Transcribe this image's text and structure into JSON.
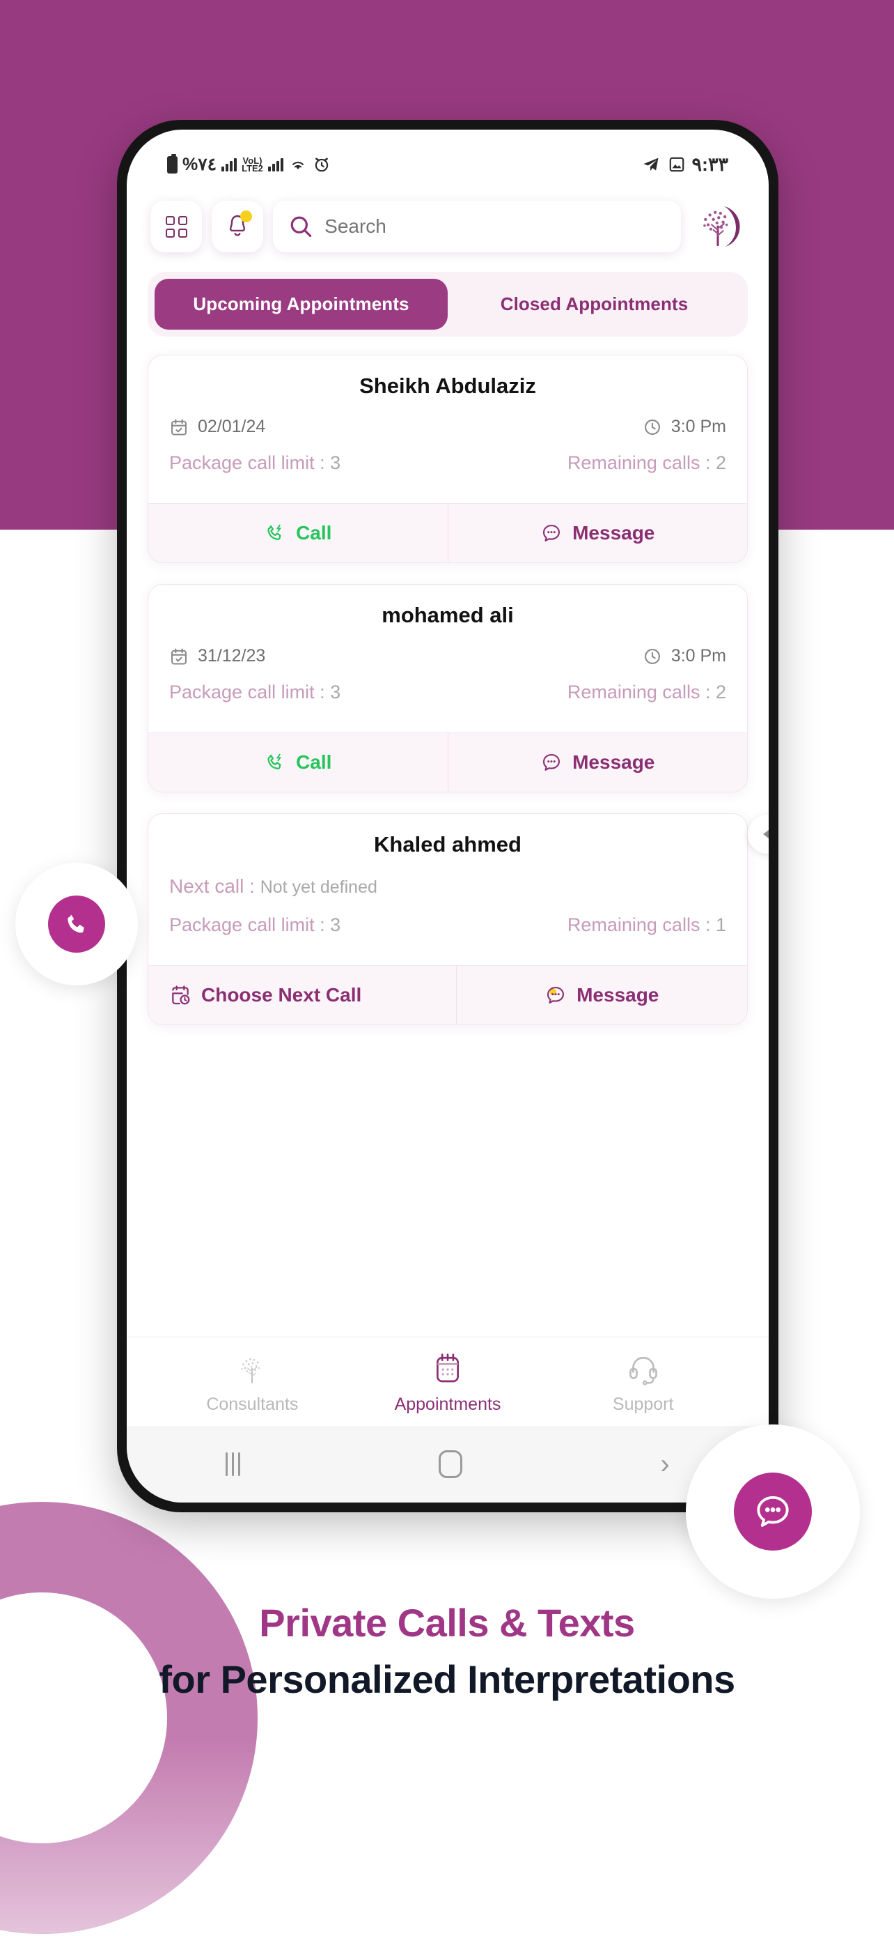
{
  "colors": {
    "brand_purple": "#983A80",
    "brand_purple_dark": "#8B2F74",
    "accent_magenta": "#B3308F",
    "call_green": "#25C55B",
    "tab_bg": "#FAF1F7",
    "ring_pink": "#C075AC",
    "bell_dot_yellow": "#F5D01E"
  },
  "statusbar": {
    "battery_text": "%٧٤",
    "network_label": "VoLTE2",
    "network_sub": "LTE2",
    "volte_top": "VoL)",
    "time": "٩:٣٣",
    "icons": [
      "battery-icon",
      "signal-bars-icon",
      "volte-icon",
      "signal-bars-2-icon",
      "wifi-icon",
      "alarm-icon",
      "telegram-icon",
      "photo-icon"
    ]
  },
  "header": {
    "grid_button": "grid-menu-button",
    "bell_button": "notifications-button",
    "search": {
      "value": "",
      "placeholder": "Search"
    },
    "logo": "tree-crescent-logo"
  },
  "tabs": [
    {
      "label": "Upcoming Appointments",
      "active": true
    },
    {
      "label": "Closed Appointments",
      "active": false
    }
  ],
  "appointments": [
    {
      "name": "Sheikh Abdulaziz",
      "date": "02/01/24",
      "time": "3:0 Pm",
      "package_label": "Package call limit :",
      "package_value": "3",
      "remaining_label": "Remaining calls :",
      "remaining_value": "2",
      "primary_action": "Call",
      "primary_kind": "call",
      "secondary_action": "Message"
    },
    {
      "name": "mohamed ali",
      "date": "31/12/23",
      "time": "3:0 Pm",
      "package_label": "Package call limit :",
      "package_value": "3",
      "remaining_label": "Remaining calls :",
      "remaining_value": "2",
      "primary_action": "Call",
      "primary_kind": "call",
      "secondary_action": "Message"
    },
    {
      "name": "Khaled ahmed",
      "next_call_label": "Next call :",
      "next_call_value": "Not yet defined",
      "package_label": "Package call limit  :",
      "package_value": "3",
      "remaining_label": "Remaining calls  :",
      "remaining_value": "1",
      "primary_action": "Choose Next Call",
      "primary_kind": "choose",
      "secondary_action": "Message"
    }
  ],
  "bottom_nav": [
    {
      "label": "Consultants",
      "icon": "tree-icon",
      "active": false
    },
    {
      "label": "Appointments",
      "icon": "calendar-icon",
      "active": true
    },
    {
      "label": "Support",
      "icon": "headset-icon",
      "active": false
    }
  ],
  "android_nav": {
    "recents": "recents-button",
    "home": "home-button",
    "back": "back-button",
    "back_glyph": "›"
  },
  "floating": {
    "call_bubble": "floating-call-button",
    "chat_bubble": "floating-chat-button"
  },
  "footer": {
    "line1": "Private Calls & Texts",
    "line2": "for Personalized Interpretations"
  }
}
